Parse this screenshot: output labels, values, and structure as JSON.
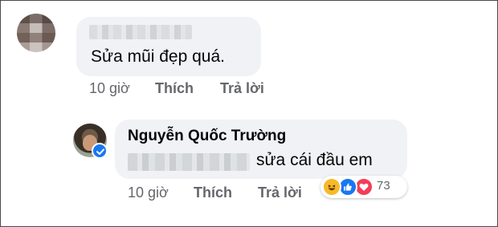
{
  "comments": [
    {
      "text": "Sửa mũi đẹp quá.",
      "time": "10 giờ",
      "like_label": "Thích",
      "reply_label": "Trả lời"
    }
  ],
  "reply": {
    "author": "Nguyễn Quốc Trường",
    "text": "sửa cái đầu em",
    "time": "10 giờ",
    "like_label": "Thích",
    "reply_label": "Trả lời",
    "reactions": {
      "icons": [
        "haha-icon",
        "like-icon",
        "love-icon"
      ],
      "count": "73"
    }
  },
  "colors": {
    "bubble": "#f0f2f5",
    "meta_text": "#65676b",
    "like_blue": "#1877f2",
    "love_red": "#f33e58",
    "haha_yellow": "#f7b928"
  }
}
